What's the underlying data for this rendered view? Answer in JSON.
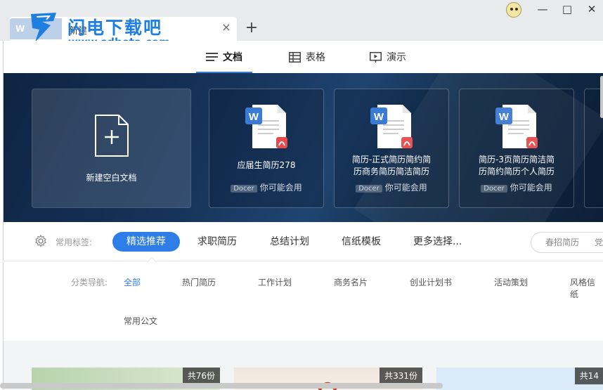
{
  "window": {
    "tab_logo": "W",
    "tab_title": "新建",
    "tab_close": "×",
    "new_tab": "+",
    "minimize": "—",
    "maximize": "□",
    "close": "✕"
  },
  "watermark": {
    "name": "闪电下载吧",
    "url": "www.sdbeta.com"
  },
  "doc_types": [
    {
      "label": "文档",
      "icon": "document-lines-icon",
      "active": true
    },
    {
      "label": "表格",
      "icon": "table-grid-icon",
      "active": false
    },
    {
      "label": "演示",
      "icon": "presentation-icon",
      "active": false
    }
  ],
  "banner": {
    "blank_card": {
      "label": "新建空白文档",
      "icon": "new-document-plus-icon"
    },
    "templates": [
      {
        "title_line1": "应届生简历278",
        "title_line2": "",
        "badge": "Docer",
        "foot": "你可能会用"
      },
      {
        "title_line1": "简历-正式简历简约简",
        "title_line2": "历商务简历简洁简历",
        "badge": "Docer",
        "foot": "你可能会用"
      },
      {
        "title_line1": "简历-3页简历简洁简",
        "title_line2": "历简约简历个人简历",
        "badge": "Docer",
        "foot": "你可能会用"
      }
    ]
  },
  "tags": {
    "label": "常用标签:",
    "items": [
      "精选推荐",
      "求职简历",
      "总结计划",
      "信纸模板",
      "更多选择..."
    ],
    "search_chips": [
      "春招简历",
      "党"
    ]
  },
  "categories": {
    "label": "分类导航:",
    "row1": [
      "全部",
      "热门简历",
      "工作计划",
      "商务名片",
      "创业计划书",
      "活动策划",
      "风格信纸"
    ],
    "row2": [
      "常用公文"
    ]
  },
  "thumbnails": [
    {
      "count": "共76份"
    },
    {
      "count": "共331份"
    },
    {
      "count": "共14"
    }
  ],
  "colors": {
    "accent": "#2f7ee8",
    "banner_dark": "#0f2442",
    "wps_red": "#e84a4a",
    "wps_blue": "#3a7bd5"
  }
}
